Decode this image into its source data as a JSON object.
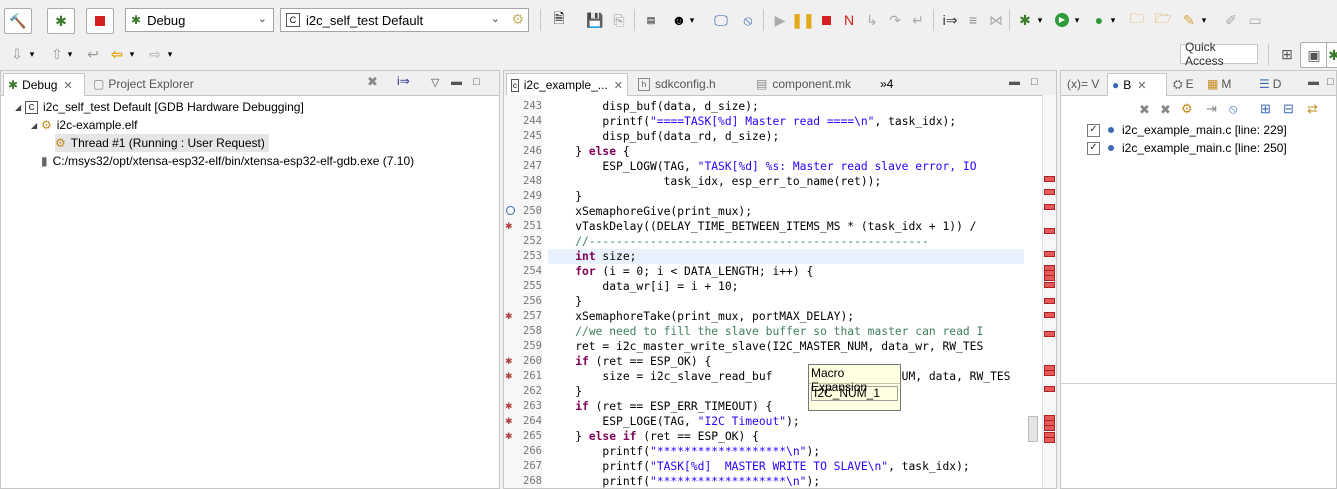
{
  "toolbar": {
    "launch_mode": "Debug",
    "launch_config": "i2c_self_test Default",
    "quick_access_placeholder": "Quick Access"
  },
  "debug_view": {
    "tabs": [
      {
        "label": "Debug",
        "active": true
      },
      {
        "label": "Project Explorer",
        "active": false
      }
    ],
    "tree": [
      {
        "label": "i2c_self_test Default [GDB Hardware Debugging]",
        "level": 0,
        "icon": "c-launch-icon"
      },
      {
        "label": "i2c-example.elf",
        "level": 1,
        "icon": "process-icon"
      },
      {
        "label": "Thread #1 (Running : User Request)",
        "level": 2,
        "icon": "thread-icon",
        "selected": true
      },
      {
        "label": "C:/msys32/opt/xtensa-esp32-elf/bin/xtensa-esp32-elf-gdb.exe (7.10)",
        "level": 1,
        "icon": "debugger-icon"
      }
    ]
  },
  "editor": {
    "tabs": [
      {
        "label": "i2c_example_...",
        "active": true
      },
      {
        "label": "sdkconfig.h",
        "active": false
      },
      {
        "label": "component.mk",
        "active": false
      }
    ],
    "overflow": "»4",
    "lines": [
      {
        "no": "243",
        "text": "        disp_buf(data, d_size);"
      },
      {
        "no": "244",
        "text": "        printf(\"====TASK[%d] Master read ====\\n\", task_idx);"
      },
      {
        "no": "245",
        "text": "        disp_buf(data_rd, d_size);"
      },
      {
        "no": "246",
        "text": "    } else {"
      },
      {
        "no": "247",
        "text": "        ESP_LOGW(TAG, \"TASK[%d] %s: Master read slave error, IO"
      },
      {
        "no": "248",
        "text": "                 task_idx, esp_err_to_name(ret));"
      },
      {
        "no": "249",
        "text": "    }"
      },
      {
        "no": "250",
        "text": "    xSemaphoreGive(print_mux);"
      },
      {
        "no": "251",
        "text": "    vTaskDelay((DELAY_TIME_BETWEEN_ITEMS_MS * (task_idx + 1)) /"
      },
      {
        "no": "252",
        "text": "    //--------------------------------------------------"
      },
      {
        "no": "253",
        "text": "    int size;"
      },
      {
        "no": "254",
        "text": "    for (i = 0; i < DATA_LENGTH; i++) {"
      },
      {
        "no": "255",
        "text": "        data_wr[i] = i + 10;"
      },
      {
        "no": "256",
        "text": "    }"
      },
      {
        "no": "257",
        "text": "    xSemaphoreTake(print_mux, portMAX_DELAY);"
      },
      {
        "no": "258",
        "text": "    //we need to fill the slave buffer so that master can read I"
      },
      {
        "no": "259",
        "text": "    ret = i2c_master_write_slave(I2C_MASTER_NUM, data_wr, RW_TES"
      },
      {
        "no": "260",
        "text": "    if (ret == ESP_OK) {"
      },
      {
        "no": "261",
        "text": "        size = i2c_slave_read_buf                 _NUM, data, RW_TES"
      },
      {
        "no": "262",
        "text": "    }"
      },
      {
        "no": "263",
        "text": "    if (ret == ESP_ERR_TIMEOUT) {"
      },
      {
        "no": "264",
        "text": "        ESP_LOGE(TAG, \"I2C Timeout\");"
      },
      {
        "no": "265",
        "text": "    } else if (ret == ESP_OK) {"
      },
      {
        "no": "266",
        "text": "        printf(\"*******************\\n\");"
      },
      {
        "no": "267",
        "text": "        printf(\"TASK[%d]  MASTER WRITE TO SLAVE\\n\", task_idx);"
      },
      {
        "no": "268",
        "text": "        printf(\"*******************\\n\");"
      }
    ],
    "tooltip": {
      "title": "Macro Expansion",
      "value": "I2C_NUM_1"
    }
  },
  "breakpoints_view": {
    "tabs": [
      {
        "label": "(x)= V"
      },
      {
        "label": "B",
        "active": true
      },
      {
        "label": "E"
      },
      {
        "label": "M"
      },
      {
        "label": "D"
      }
    ],
    "items": [
      {
        "label": "i2c_example_main.c [line: 229]",
        "checked": true
      },
      {
        "label": "i2c_example_main.c [line: 250]",
        "checked": true
      }
    ]
  }
}
